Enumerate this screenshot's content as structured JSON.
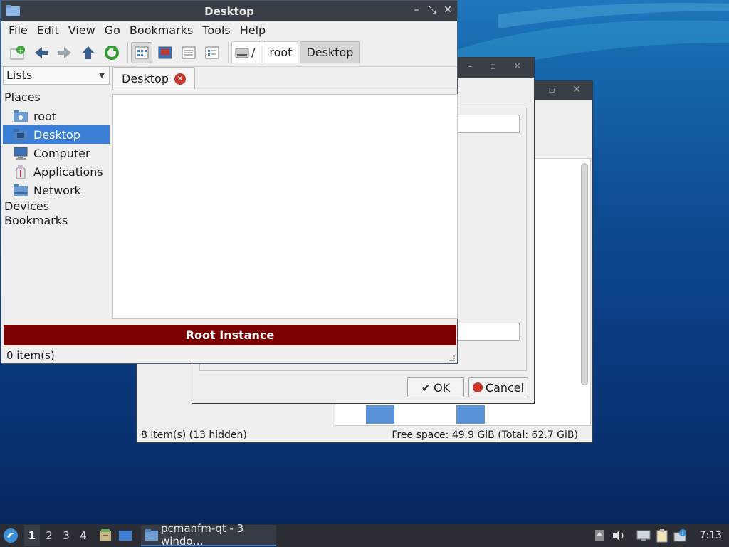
{
  "window": {
    "title": "Desktop",
    "menu": [
      "File",
      "Edit",
      "View",
      "Go",
      "Bookmarks",
      "Tools",
      "Help"
    ],
    "path": [
      "/",
      "root",
      "Desktop"
    ],
    "side": {
      "selector": "Lists",
      "places_label": "Places",
      "places": [
        "root",
        "Desktop",
        "Computer",
        "Applications",
        "Network"
      ],
      "devices_label": "Devices",
      "bookmarks_label": "Bookmarks"
    },
    "tab_label": "Desktop",
    "root_banner": "Root Instance",
    "status": "0 item(s)"
  },
  "background_window": {
    "status_left": "8 item(s) (13 hidden)",
    "status_right": "Free space: 49.9 GiB (Total: 62.7 GiB)"
  },
  "dialog": {
    "ok_label": "OK",
    "cancel_label": "Cancel"
  },
  "taskbar": {
    "workspaces": [
      "1",
      "2",
      "3",
      "4"
    ],
    "task_label": "pcmanfm-qt - 3 windo…",
    "clock": "7:13"
  },
  "colors": {
    "selection": "#3b7fd6",
    "root_banner": "#7d0000",
    "titlebar": "#3a3f47"
  }
}
